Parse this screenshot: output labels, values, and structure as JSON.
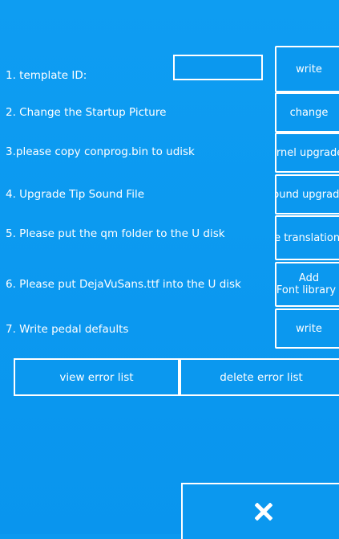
{
  "items": [
    {
      "label": "1. template ID:",
      "button": "write"
    },
    {
      "label": "2. Change the Startup Picture",
      "button": "change"
    },
    {
      "label": "3.please copy conprog.bin to udisk",
      "button": "Kernel upgrade"
    },
    {
      "label": "4. Upgrade Tip Sound File",
      "button": "Sound upgrade"
    },
    {
      "label": "5. Please put the qm folder to the U disk",
      "button": "Update translation"
    },
    {
      "label": "6. Please put DejaVuSans.ttf into the U disk",
      "button_line1": "Add",
      "button_line2": "Font library"
    },
    {
      "label": "7. Write pedal defaults",
      "button": "write"
    }
  ],
  "template_id": {
    "value": ""
  },
  "bottom": {
    "view_error_list": "view error list",
    "delete_error_list": "delete error list"
  },
  "close_icon": "close-x-icon",
  "colors": {
    "background": "#0b99f0",
    "foreground": "#ffffff"
  }
}
